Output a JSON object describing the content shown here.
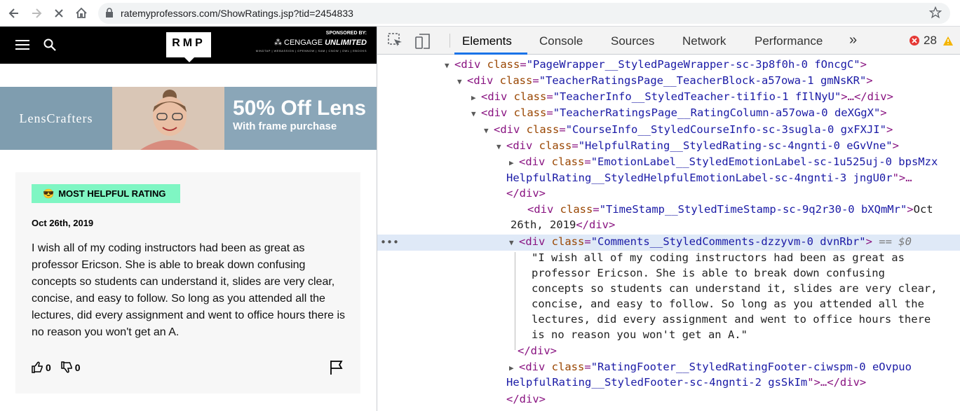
{
  "browser": {
    "url": "ratemyprofessors.com/ShowRatings.jsp?tid=2454833"
  },
  "site": {
    "logo": "RMP",
    "sponsor_label": "SPONSORED BY:",
    "sponsor_brand_a": "CENGAGE",
    "sponsor_brand_b": "UNLIMITED",
    "sponsor_sub": "MINDTAP | WEBASSIGN | OPENNOW | SAM | CNOW | OWL | EBOOKS"
  },
  "ad": {
    "brand": "LensCrafters",
    "headline": "50% Off Lens",
    "subline": "With frame purchase"
  },
  "rating": {
    "badge": "MOST HELPFUL RATING",
    "badge_emoji": "😎",
    "date": "Oct 26th, 2019",
    "comment": "I wish all of my coding instructors had been as great as professor Ericson. She is able to break down confusing concepts so students can understand it, slides are very clear, concise, and easy to follow. So long as you attended all the lectures, did every assignment and went to office hours there is no reason you won't get an A.",
    "thumbs_up": "0",
    "thumbs_down": "0"
  },
  "devtools": {
    "tabs": [
      "Elements",
      "Console",
      "Sources",
      "Network",
      "Performance"
    ],
    "more": "»",
    "error_count": "28",
    "lines": [
      {
        "tri": "▼",
        "tag": "div",
        "attr": "class",
        "val": "PageWrapper__StyledPageWrapper-sc-3p8f0h-0 fOncgC",
        "end": ">"
      },
      {
        "tri": "▼",
        "tag": "div",
        "attr": "class",
        "val": "TeacherRatingsPage__TeacherBlock-a57owa-1 gmNsKR",
        "end": ">"
      },
      {
        "tri": "▶",
        "tag": "div",
        "attr": "class",
        "val": "TeacherInfo__StyledTeacher-ti1fio-1 fIlNyU",
        "end": ">…</div>"
      },
      {
        "tri": "▼",
        "tag": "div",
        "attr": "class",
        "val": "TeacherRatingsPage__RatingColumn-a57owa-0 deXGgX",
        "end": ">"
      },
      {
        "tri": "▼",
        "tag": "div",
        "attr": "class",
        "val": "CourseInfo__StyledCourseInfo-sc-3sugla-0 gxFXJI",
        "end": ">"
      },
      {
        "tri": "▼",
        "tag": "div",
        "attr": "class",
        "val": "HelpfulRating__StyledRating-sc-4ngnti-0 eGvVne",
        "end": ">"
      },
      {
        "tri": "▶",
        "tag": "div",
        "attr": "class",
        "val": "EmotionLabel__StyledEmotionLabel-sc-1u525uj-0 bpsMzx",
        "end": ""
      },
      {
        "cont": "HelpfulRating__StyledHelpfulEmotionLabel-sc-4ngnti-3 jngU0r",
        "end": "\">…"
      },
      {
        "close": "</div>"
      },
      {
        "tri": "",
        "tag": "div",
        "attr": "class",
        "val": "TimeStamp__StyledTimeStamp-sc-9q2r30-0 bXQmMr",
        "end": ">",
        "text": "Oct"
      },
      {
        "text_only": "26th, 2019",
        "close_tail": "</div>"
      },
      {
        "tri": "▼",
        "tag": "div",
        "attr": "class",
        "val": "Comments__StyledComments-dzzyvm-0 dvnRbr",
        "end": ">",
        "suffix": " == $0"
      },
      {
        "text_only": "\"I wish all of my coding instructors had been as great as"
      },
      {
        "text_only": "professor Ericson. She is able to break down confusing"
      },
      {
        "text_only": "concepts so students can understand it, slides are very clear,"
      },
      {
        "text_only": "concise, and easy to follow. So long as you attended all the"
      },
      {
        "text_only": "lectures, did every assignment and went to office hours there"
      },
      {
        "text_only": "is no reason you won't get an A.\""
      },
      {
        "close": "</div>"
      },
      {
        "tri": "▶",
        "tag": "div",
        "attr": "class",
        "val": "RatingFooter__StyledRatingFooter-ciwspm-0 eOvpuo",
        "end": ""
      },
      {
        "cont": "HelpfulRating__StyledFooter-sc-4ngnti-2 gsSkIm",
        "end": "\">…</div>"
      },
      {
        "close": "</div>"
      }
    ]
  }
}
